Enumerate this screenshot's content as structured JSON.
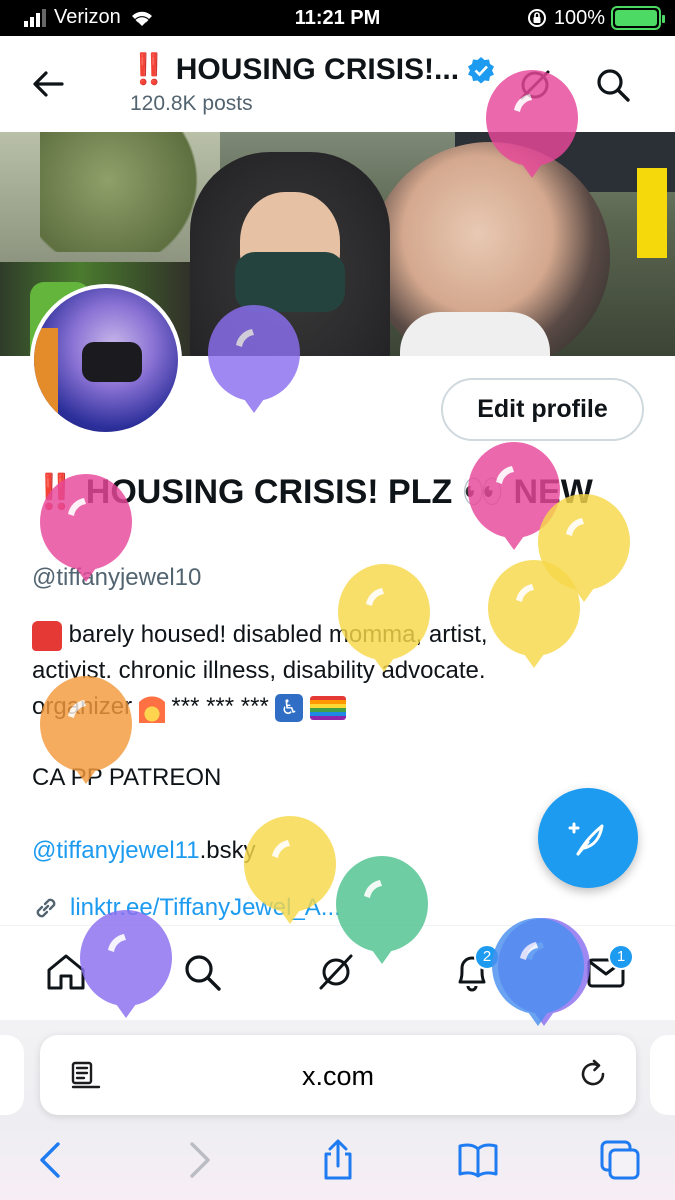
{
  "status_bar": {
    "carrier": "Verizon",
    "time": "11:21 PM",
    "battery": "100%"
  },
  "header": {
    "title": "‼️ HOUSING CRISIS!...",
    "posts": "120.8K posts"
  },
  "profile": {
    "edit_label": "Edit profile",
    "name": "‼️ HOUSING CRISIS! PLZ 👀 NEW",
    "handle": "@tiffanyjewel10",
    "bio_1": "barely housed! disabled momma, artist,",
    "bio_2": "activist. chronic illness, disability advocate.",
    "bio_3": "organizer",
    "bio_3_tail": "*** *** ***",
    "patreon": "CA PP PATREON",
    "bsky_link": "@tiffanyjewel11",
    "bsky_suffix": ".bsky",
    "website": "linktr.ee/TiffanyJewel_A..."
  },
  "tabbar": {
    "notifications_badge": "2",
    "messages_badge": "1"
  },
  "safari": {
    "url": "x.com"
  },
  "colors": {
    "accent": "#1d9bf0",
    "balloon_pink": "#e8489a",
    "balloon_purple": "#8b6ff0",
    "balloon_yellow": "#f7d84a",
    "balloon_orange": "#f39a3c",
    "balloon_green": "#4fc38f",
    "balloon_blue": "#4a8ff0"
  }
}
